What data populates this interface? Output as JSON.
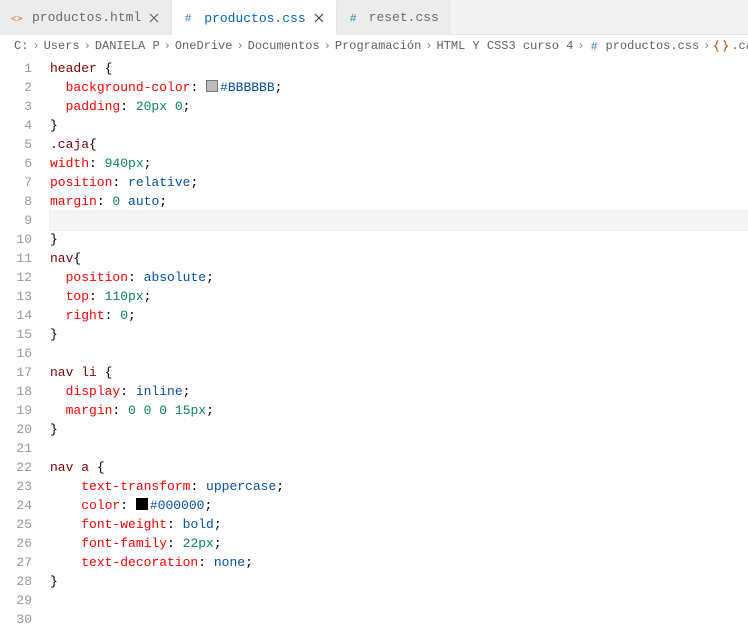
{
  "tabs": [
    {
      "label": "productos.html",
      "icon": "html"
    },
    {
      "label": "productos.css",
      "icon": "css",
      "active": true,
      "dirty": true
    },
    {
      "label": "reset.css",
      "icon": "css"
    }
  ],
  "breadcrumb": {
    "parts": [
      "C:",
      "Users",
      "DANIELA P",
      "OneDrive",
      "Documentos",
      "Programación",
      "HTML Y CSS3 curso 4"
    ],
    "file": "productos.css",
    "symbol": ".caja"
  },
  "code": {
    "lines": [
      {
        "n": 1,
        "tokens": [
          [
            "sel",
            "header "
          ],
          [
            "punc",
            "{"
          ]
        ]
      },
      {
        "n": 2,
        "tokens": [
          [
            "ind",
            "  "
          ],
          [
            "prop",
            "background-color"
          ],
          [
            "punc",
            ": "
          ],
          [
            "swatch",
            "#BBBBBB"
          ],
          [
            "hex",
            "#BBBBBB"
          ],
          [
            "punc",
            ";"
          ]
        ]
      },
      {
        "n": 3,
        "tokens": [
          [
            "ind",
            "  "
          ],
          [
            "prop",
            "padding"
          ],
          [
            "punc",
            ": "
          ],
          [
            "num",
            "20px"
          ],
          [
            "punc",
            " "
          ],
          [
            "num",
            "0"
          ],
          [
            "punc",
            ";"
          ]
        ]
      },
      {
        "n": 4,
        "tokens": [
          [
            "punc",
            "}"
          ]
        ]
      },
      {
        "n": 5,
        "tokens": [
          [
            "sel",
            ".caja"
          ],
          [
            "punc",
            "{"
          ]
        ]
      },
      {
        "n": 6,
        "tokens": [
          [
            "prop",
            "width"
          ],
          [
            "punc",
            ": "
          ],
          [
            "num",
            "940px"
          ],
          [
            "punc",
            ";"
          ]
        ]
      },
      {
        "n": 7,
        "tokens": [
          [
            "prop",
            "position"
          ],
          [
            "punc",
            ": "
          ],
          [
            "val",
            "relative"
          ],
          [
            "punc",
            ";"
          ]
        ]
      },
      {
        "n": 8,
        "tokens": [
          [
            "prop",
            "margin"
          ],
          [
            "punc",
            ": "
          ],
          [
            "num",
            "0"
          ],
          [
            "punc",
            " "
          ],
          [
            "val",
            "auto"
          ],
          [
            "punc",
            ";"
          ]
        ]
      },
      {
        "n": 9,
        "tokens": [],
        "current": true
      },
      {
        "n": 10,
        "tokens": [
          [
            "punc",
            "}"
          ]
        ]
      },
      {
        "n": 11,
        "tokens": [
          [
            "sel",
            "nav"
          ],
          [
            "punc",
            "{"
          ]
        ]
      },
      {
        "n": 12,
        "tokens": [
          [
            "ind",
            "  "
          ],
          [
            "prop",
            "position"
          ],
          [
            "punc",
            ": "
          ],
          [
            "val",
            "absolute"
          ],
          [
            "punc",
            ";"
          ]
        ]
      },
      {
        "n": 13,
        "tokens": [
          [
            "ind",
            "  "
          ],
          [
            "prop",
            "top"
          ],
          [
            "punc",
            ": "
          ],
          [
            "num",
            "110px"
          ],
          [
            "punc",
            ";"
          ]
        ]
      },
      {
        "n": 14,
        "tokens": [
          [
            "ind",
            "  "
          ],
          [
            "prop",
            "right"
          ],
          [
            "punc",
            ": "
          ],
          [
            "num",
            "0"
          ],
          [
            "punc",
            ";"
          ]
        ]
      },
      {
        "n": 15,
        "tokens": [
          [
            "punc",
            "}"
          ]
        ]
      },
      {
        "n": 16,
        "tokens": []
      },
      {
        "n": 17,
        "tokens": [
          [
            "sel",
            "nav li "
          ],
          [
            "punc",
            "{"
          ]
        ]
      },
      {
        "n": 18,
        "tokens": [
          [
            "ind",
            "  "
          ],
          [
            "prop",
            "display"
          ],
          [
            "punc",
            ": "
          ],
          [
            "val",
            "inline"
          ],
          [
            "punc",
            ";"
          ]
        ]
      },
      {
        "n": 19,
        "tokens": [
          [
            "ind",
            "  "
          ],
          [
            "prop",
            "margin"
          ],
          [
            "punc",
            ": "
          ],
          [
            "num",
            "0"
          ],
          [
            "punc",
            " "
          ],
          [
            "num",
            "0"
          ],
          [
            "punc",
            " "
          ],
          [
            "num",
            "0"
          ],
          [
            "punc",
            " "
          ],
          [
            "num",
            "15px"
          ],
          [
            "punc",
            ";"
          ]
        ]
      },
      {
        "n": 20,
        "tokens": [
          [
            "punc",
            "}"
          ]
        ]
      },
      {
        "n": 21,
        "tokens": []
      },
      {
        "n": 22,
        "tokens": [
          [
            "sel",
            "nav a "
          ],
          [
            "punc",
            "{"
          ]
        ]
      },
      {
        "n": 23,
        "tokens": [
          [
            "ind",
            "    "
          ],
          [
            "prop",
            "text-transform"
          ],
          [
            "punc",
            ": "
          ],
          [
            "val",
            "uppercase"
          ],
          [
            "punc",
            ";"
          ]
        ]
      },
      {
        "n": 24,
        "tokens": [
          [
            "ind",
            "    "
          ],
          [
            "prop",
            "color"
          ],
          [
            "punc",
            ": "
          ],
          [
            "swatch",
            "#000000"
          ],
          [
            "hex",
            "#000000"
          ],
          [
            "punc",
            ";"
          ]
        ]
      },
      {
        "n": 25,
        "tokens": [
          [
            "ind",
            "    "
          ],
          [
            "prop",
            "font-weight"
          ],
          [
            "punc",
            ": "
          ],
          [
            "val",
            "bold"
          ],
          [
            "punc",
            ";"
          ]
        ]
      },
      {
        "n": 26,
        "tokens": [
          [
            "ind",
            "    "
          ],
          [
            "prop",
            "font-family"
          ],
          [
            "punc",
            ": "
          ],
          [
            "num",
            "22px"
          ],
          [
            "punc",
            ";"
          ]
        ]
      },
      {
        "n": 27,
        "tokens": [
          [
            "ind",
            "    "
          ],
          [
            "prop",
            "text-decoration"
          ],
          [
            "punc",
            ": "
          ],
          [
            "val",
            "none"
          ],
          [
            "punc",
            ";"
          ]
        ]
      },
      {
        "n": 28,
        "tokens": [
          [
            "punc",
            "}"
          ]
        ]
      },
      {
        "n": 29,
        "tokens": []
      },
      {
        "n": 30,
        "tokens": []
      }
    ]
  }
}
